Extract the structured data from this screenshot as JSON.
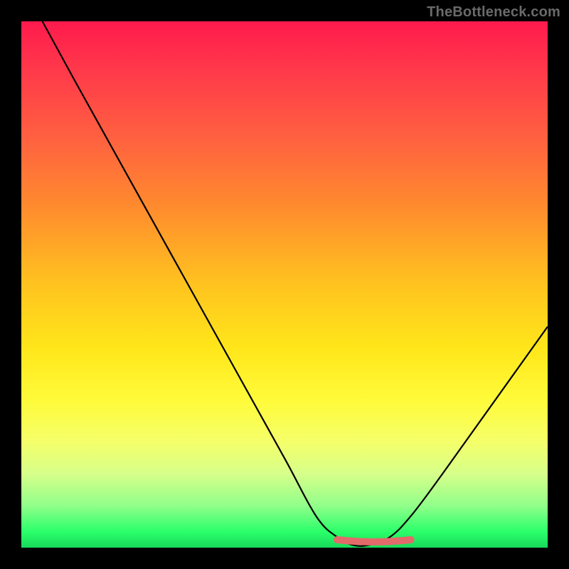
{
  "watermark": "TheBottleneck.com",
  "chart_data": {
    "type": "line",
    "title": "",
    "xlabel": "",
    "ylabel": "",
    "xlim": [
      0,
      100
    ],
    "ylim": [
      0,
      100
    ],
    "grid": false,
    "series": [
      {
        "name": "bottleneck-curve",
        "x": [
          4,
          10,
          20,
          30,
          40,
          50,
          56,
          60,
          63,
          66,
          70,
          74,
          80,
          90,
          100
        ],
        "y": [
          100,
          89,
          71,
          53,
          35,
          17,
          6,
          2,
          0.5,
          0.5,
          2,
          6,
          14,
          28,
          42
        ]
      }
    ],
    "highlight": {
      "name": "optimal-range",
      "x": [
        60,
        74
      ],
      "y": [
        1.5,
        1.5
      ],
      "color": "#e26a6a"
    },
    "background_gradient": {
      "top": "#ff1a4d",
      "bottom": "#18d95a"
    }
  }
}
